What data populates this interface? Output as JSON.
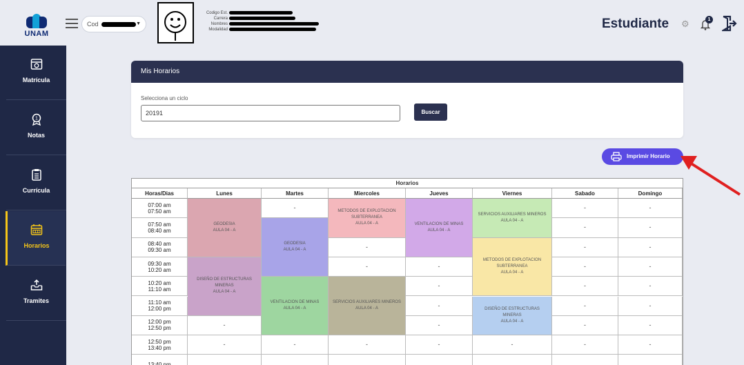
{
  "header": {
    "logo_text": "UNAM",
    "cod_label": "Cod",
    "student_fields": [
      "Codigo Est.",
      "Carrera",
      "Nombres",
      "Modalidad"
    ],
    "role_title": "Estudiante",
    "notification_count": "1"
  },
  "sidebar": {
    "items": [
      {
        "label": "Matrícula",
        "icon": "enrollment-icon"
      },
      {
        "label": "Notas",
        "icon": "award-icon"
      },
      {
        "label": "Currícula",
        "icon": "clipboard-icon"
      },
      {
        "label": "Horarios",
        "icon": "calendar-icon"
      },
      {
        "label": "Tramites",
        "icon": "inbox-upload-icon"
      }
    ],
    "active": "Horarios"
  },
  "panel": {
    "title": "Mis Horarios",
    "field_label": "Selecciona un ciclo",
    "ciclo_value": "20191",
    "search_button": "Buscar"
  },
  "print_button": "Imprimir Horario",
  "schedule": {
    "title": "Horarios",
    "days_header": [
      "Horas/Dias",
      "Lunes",
      "Martes",
      "Miercoles",
      "Jueves",
      "Viernes",
      "Sabado",
      "Domingo"
    ],
    "time_slots": [
      [
        "07:00 am",
        "07:50 am"
      ],
      [
        "07:50 am",
        "08:40 am"
      ],
      [
        "08:40 am",
        "09:30 am"
      ],
      [
        "09:30 am",
        "10:20 am"
      ],
      [
        "10:20 am",
        "11:10 am"
      ],
      [
        "11:10 am",
        "12:00 pm"
      ],
      [
        "12:00 pm",
        "12:50 pm"
      ],
      [
        "12:50 pm",
        "13:40 pm"
      ],
      [
        "13:40 pm",
        ""
      ]
    ],
    "empty_mark": "-",
    "courses": [
      {
        "day": 1,
        "start": 0,
        "span": 3,
        "name": "GEODESIA",
        "room": "AULA 04 - A",
        "color": "#dba6b0"
      },
      {
        "day": 1,
        "start": 3,
        "span": 3,
        "name": "DISEÑO DE ESTRUCTURAS MINERAS",
        "room": "AULA 04 - A",
        "color": "#c9a3c9"
      },
      {
        "day": 2,
        "start": 1,
        "span": 3,
        "name": "GEODESIA",
        "room": "AULA 04 - A",
        "color": "#a8a4e8"
      },
      {
        "day": 2,
        "start": 4,
        "span": 3,
        "name": "VENTILACION DE MINAS",
        "room": "AULA 04 - A",
        "color": "#9ed6a0"
      },
      {
        "day": 3,
        "start": 0,
        "span": 2,
        "name": "METODOS DE EXPLOTACION SUBTERRANEA",
        "room": "AULA 04 - A",
        "color": "#f4b8bd"
      },
      {
        "day": 3,
        "start": 4,
        "span": 3,
        "name": "SERVICIOS AUXILIARES MINEROS",
        "room": "AULA 04 - A",
        "color": "#b9b49a"
      },
      {
        "day": 4,
        "start": 0,
        "span": 3,
        "name": "VENTILACION DE MINAS",
        "room": "AULA 04 - A",
        "color": "#d2a9e8"
      },
      {
        "day": 5,
        "start": 0,
        "span": 2,
        "name": "SERVICIOS AUXILIARES MINEROS",
        "room": "AULA 04 - A",
        "color": "#c6eab5"
      },
      {
        "day": 5,
        "start": 2,
        "span": 3,
        "name": "METODOS DE EXPLOTACION SUBTERRANEA",
        "room": "AULA 04 - A",
        "color": "#f9e7a6"
      },
      {
        "day": 5,
        "start": 5,
        "span": 2,
        "name": "DISEÑO DE ESTRUCTURAS MINERAS",
        "room": "AULA 04 - A",
        "color": "#b5cff0"
      }
    ]
  },
  "colors": {
    "sidebar_bg": "#1f2846",
    "active_accent": "#f5c518",
    "print_button_bg": "#5a4ae3",
    "annotation_arrow": "#e02020"
  }
}
